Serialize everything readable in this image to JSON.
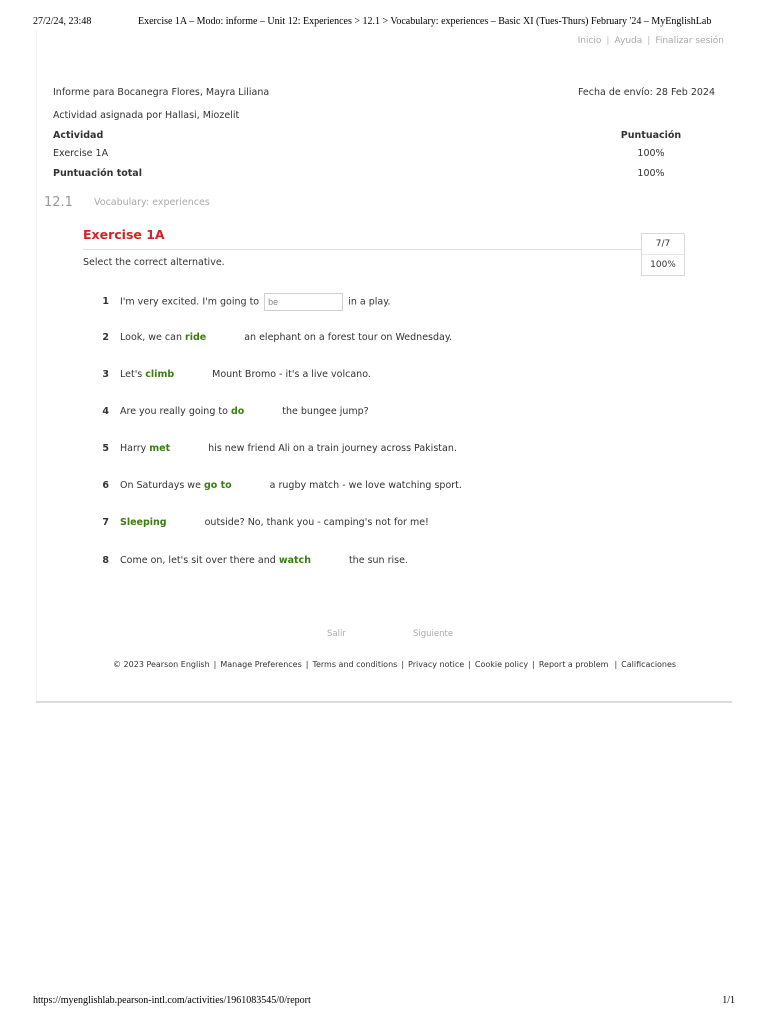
{
  "print": {
    "date": "27/2/24, 23:48",
    "title": "Exercise 1A – Modo: informe – Unit 12: Experiences > 12.1 > Vocabulary: experiences – Basic XI (Tues-Thurs) February '24 – MyEnglishLab",
    "url": "https://myenglishlab.pearson-intl.com/activities/1961083545/0/report",
    "page": "1/1"
  },
  "top_links": {
    "home": "Inicio",
    "help": "Ayuda",
    "logout": "Finalizar sesión",
    "separator": "|"
  },
  "report": {
    "report_for": "Informe para Bocanegra Flores, Mayra Liliana",
    "send_date": "Fecha de envío: 28 Feb 2024",
    "assigned_by": "Actividad asignada por Hallasi, Miozelit",
    "col_activity": "Actividad",
    "col_score": "Puntuación",
    "row_activity": "Exercise 1A",
    "row_score": "100%",
    "total_label": "Puntuación total",
    "total_score": "100%"
  },
  "section": {
    "number": "12.1",
    "title": "Vocabulary: experiences"
  },
  "exercise": {
    "title": "Exercise 1A",
    "instruction": "Select the correct alternative.",
    "score_fraction": "7/7",
    "score_percent": "100%"
  },
  "questions": [
    {
      "num": "1",
      "before": "I'm very excited. I'm going to",
      "input_value": "be",
      "after": "in a play."
    },
    {
      "num": "2",
      "before": "Look, we can",
      "answer": "ride",
      "after": "an elephant on a forest tour on Wednesday."
    },
    {
      "num": "3",
      "before": "Let's",
      "answer": "climb",
      "after": "Mount Bromo - it's a live volcano."
    },
    {
      "num": "4",
      "before": "Are you really going to",
      "answer": "do",
      "after": "the bungee jump?"
    },
    {
      "num": "5",
      "before": "Harry",
      "answer": "met",
      "after": "his new friend Ali on a train journey across Pakistan."
    },
    {
      "num": "6",
      "before": "On Saturdays we",
      "answer": "go to",
      "after": "a rugby match - we love watching sport."
    },
    {
      "num": "7",
      "before": "",
      "answer": "Sleeping",
      "after": "outside? No, thank you - camping's not for me!"
    },
    {
      "num": "8",
      "before": "Come on, let's sit over there and",
      "answer": "watch",
      "after": "the sun rise."
    }
  ],
  "nav": {
    "exit": "Salir",
    "next": "Siguiente"
  },
  "footer": {
    "copyright": "© 2023 Pearson English",
    "manage": "Manage Preferences",
    "terms": "Terms and conditions",
    "privacy": "Privacy notice",
    "cookie": "Cookie policy",
    "report_problem": "Report a problem",
    "grades": "Calificaciones",
    "separator": "|"
  }
}
